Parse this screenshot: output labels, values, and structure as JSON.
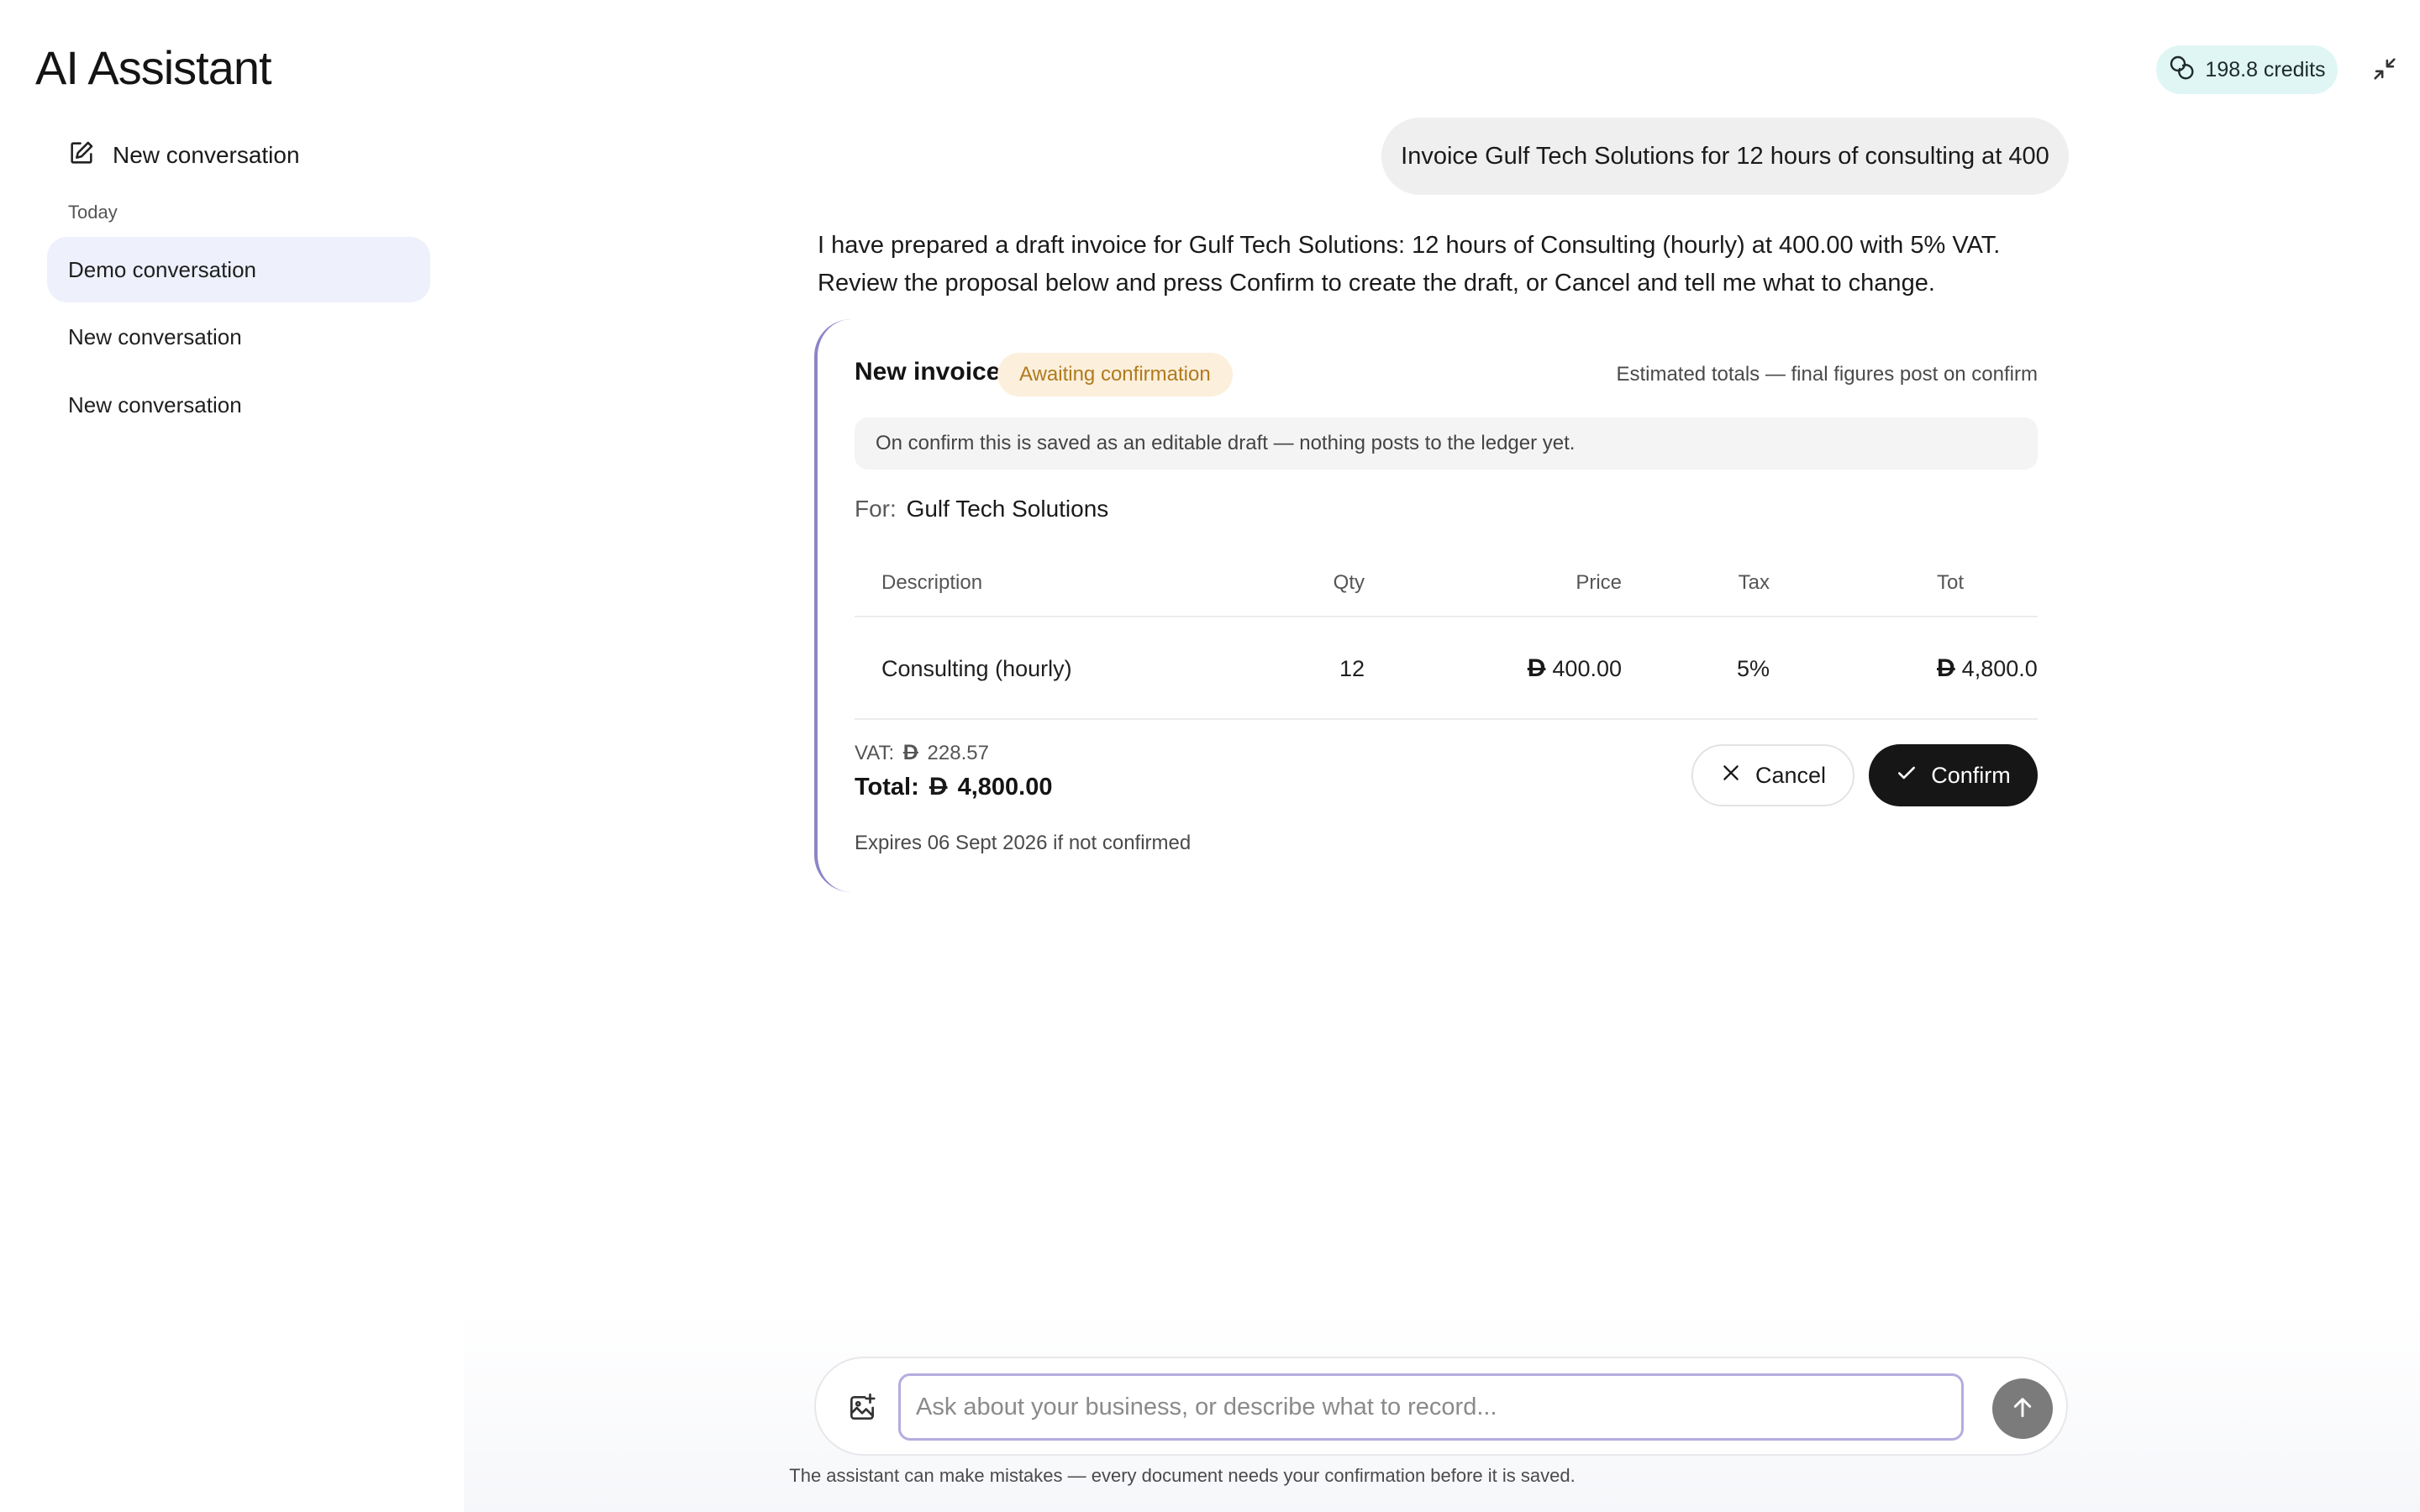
{
  "app": {
    "title": "AI Assistant"
  },
  "header": {
    "credits": "198.8 credits"
  },
  "sidebar": {
    "new_conversation": "New conversation",
    "section_label": "Today",
    "items": [
      {
        "label": "Demo conversation",
        "active": true
      },
      {
        "label": "New conversation",
        "active": false
      },
      {
        "label": "New conversation",
        "active": false
      }
    ]
  },
  "chat": {
    "user_message": "Invoice Gulf Tech Solutions for 12 hours of consulting at 400",
    "assistant_message": "I have prepared a draft invoice for Gulf Tech Solutions: 12 hours of Consulting (hourly) at 400.00 with 5% VAT. Review the proposal below and press Confirm to create the draft, or Cancel and tell me what to change."
  },
  "invoice_card": {
    "title": "New invoice",
    "status": "Awaiting confirmation",
    "estimate_note": "Estimated totals — final figures post on confirm",
    "draft_note": "On confirm this is saved as an editable draft — nothing posts to the ledger yet.",
    "for_label": "For:",
    "customer": "Gulf Tech Solutions",
    "currency_symbol": "D",
    "columns": {
      "description": "Description",
      "qty": "Qty",
      "price": "Price",
      "tax": "Tax",
      "total": "Tot"
    },
    "lines": [
      {
        "description": "Consulting (hourly)",
        "qty": "12",
        "price": "400.00",
        "tax": "5%",
        "total": "4,800.0"
      }
    ],
    "vat_label": "VAT:",
    "vat_amount": "228.57",
    "total_label": "Total:",
    "total_amount": "4,800.00",
    "expires": "Expires 06 Sept 2026 if not confirmed",
    "cancel_label": "Cancel",
    "confirm_label": "Confirm"
  },
  "composer": {
    "placeholder": "Ask about your business, or describe what to record...",
    "disclaimer": "The assistant can make mistakes — every document needs your confirmation before it is saved."
  },
  "colors": {
    "accent_bar": "#8c86c8",
    "credits_bg": "#dff6f4",
    "badge_bg": "#fcefdc",
    "badge_text": "#b07a1c",
    "active_item_bg": "#eef0fc",
    "confirm_bg": "#161616"
  }
}
